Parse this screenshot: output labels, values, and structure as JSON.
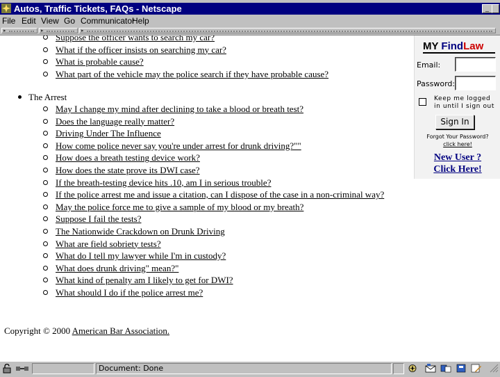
{
  "window": {
    "title": "Autos, Traffic Tickets, FAQs - Netscape"
  },
  "menu": {
    "file": "File",
    "edit": "Edit",
    "view": "View",
    "go": "Go",
    "communicator": "Communicator",
    "help": "Help"
  },
  "top_links": [
    "Suppose the officer wants to search my car?",
    "What if the officer insists on searching my car?",
    "What is probable cause?",
    "What part of the vehicle may the police search if they have probable cause?"
  ],
  "arrest_heading": "The Arrest",
  "arrest_links": [
    "May I change my mind after declining to take a blood or breath test?",
    "Does the language really matter?",
    "Driving Under The Influence",
    "How come police never say you're under arrest for drunk driving?\"\"",
    "How does a breath testing device work?",
    "How does the state prove its DWI case?",
    "If the breath-testing device hits .10, am I in serious trouble?",
    "If the police arrest me and issue a citation, can I dispose of the case in a non-criminal way?",
    "May the police force me to give a sample of my blood or my breath?",
    "Suppose I fail the tests?",
    "The Nationwide Crackdown on Drunk Driving",
    "What are field sobriety tests?",
    "What do I tell my lawyer while I'm in custody?",
    "What does drunk driving\" mean?\"",
    "What kind of penalty am I likely to get for DWI?",
    "What should I do if the police arrest me?"
  ],
  "copyright": {
    "prefix": "Copyright © 2000 ",
    "link": "American Bar Association."
  },
  "findlaw": {
    "logo_my": "MY ",
    "logo_find": "Find",
    "logo_law": "Law",
    "email_label": "Email:",
    "password_label": "Password:",
    "keep_logged": "Keep me logged in until I sign out",
    "sign_in": "Sign In",
    "forgot": "Forgot Your Password?",
    "click_here_small": "click here!",
    "new_user": "New User ?",
    "click_here": "Click Here!"
  },
  "status": {
    "text": "Document: Done"
  }
}
